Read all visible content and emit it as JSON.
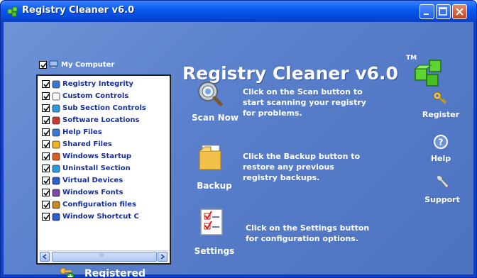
{
  "window": {
    "title": "Registry Cleaner v6.0"
  },
  "tree": {
    "root_label": "My Computer",
    "items": [
      {
        "label": "Registry Integrity",
        "icon": "registry-icon"
      },
      {
        "label": "Custom Controls",
        "icon": "document-icon"
      },
      {
        "label": "Sub Section Controls",
        "icon": "molecule-icon"
      },
      {
        "label": "Software Locations",
        "icon": "software-icon"
      },
      {
        "label": "Help Files",
        "icon": "help-file-icon"
      },
      {
        "label": "Shared Files",
        "icon": "star-icon"
      },
      {
        "label": "Windows Startup",
        "icon": "windows-flag-icon"
      },
      {
        "label": "Uninstall Section",
        "icon": "uninstall-icon"
      },
      {
        "label": "Virtual Devices",
        "icon": "device-icon"
      },
      {
        "label": "Windows Fonts",
        "icon": "font-icon"
      },
      {
        "label": "Configuration files",
        "icon": "config-file-icon"
      },
      {
        "label": "Window Shortcut C",
        "icon": "shortcut-icon"
      }
    ],
    "scroll_thumb_glyph": "III"
  },
  "status": {
    "registered_label": "Registered"
  },
  "banner": {
    "title": "Registry Cleaner v6.0",
    "trademark": "TM"
  },
  "actions": {
    "scan": {
      "label": "Scan Now",
      "description": "Click on the Scan button to start scanning your registry for problems."
    },
    "backup": {
      "label": "Backup",
      "description": "Click the Backup button to restore any previous registry backups."
    },
    "settings": {
      "label": "Settings",
      "description": "Click on the Settings button for configuration options."
    }
  },
  "side": {
    "register_label": "Register",
    "help_label": "Help",
    "support_label": "Support"
  }
}
